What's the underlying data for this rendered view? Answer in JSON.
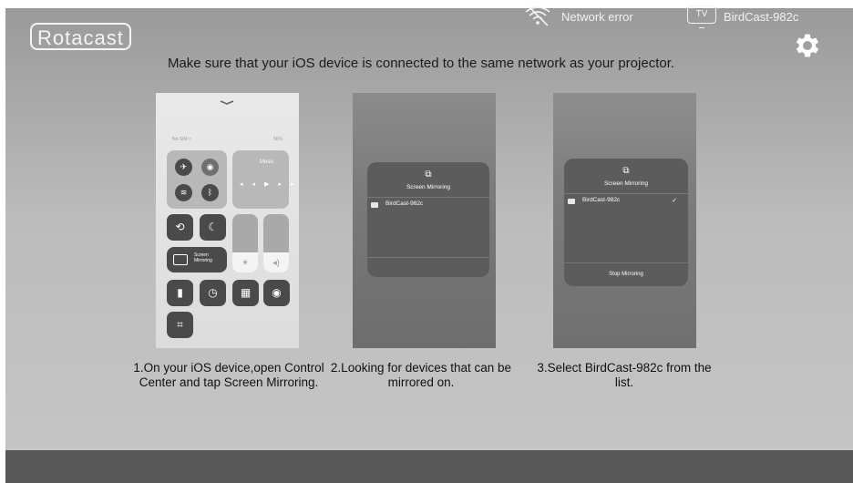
{
  "app": {
    "logo_text": "Rotacast"
  },
  "header": {
    "instruction": "Make sure that your iOS device is connected to the same network as your projector."
  },
  "icons": {
    "settings": "gear-icon",
    "network": "wifi-off-icon",
    "device": "tv-icon"
  },
  "steps": [
    {
      "caption": "1.On your iOS device,open Control Center and tap Screen Mirroring."
    },
    {
      "caption": "2.Looking for devices that can be mirrored on."
    },
    {
      "caption": "3.Select BirdCast-982c from the list."
    }
  ],
  "control_center": {
    "status_left": "No SIM ≈",
    "status_right": "56%",
    "music_label": "Music",
    "mirroring_label_1": "Screen",
    "mirroring_label_2": "Mirroring"
  },
  "popup": {
    "title": "Screen Mirroring",
    "device_name": "BirdCast-982c",
    "stop_label": "Stop Mirroring",
    "check": "✓"
  },
  "status_bar": {
    "network_status": "Network error",
    "tv_badge": "TV",
    "device_name": "BirdCast-982c"
  },
  "colors": {
    "background": "#bcbcbc",
    "status_bar": "#575757",
    "popup": "#5c5c5c"
  }
}
